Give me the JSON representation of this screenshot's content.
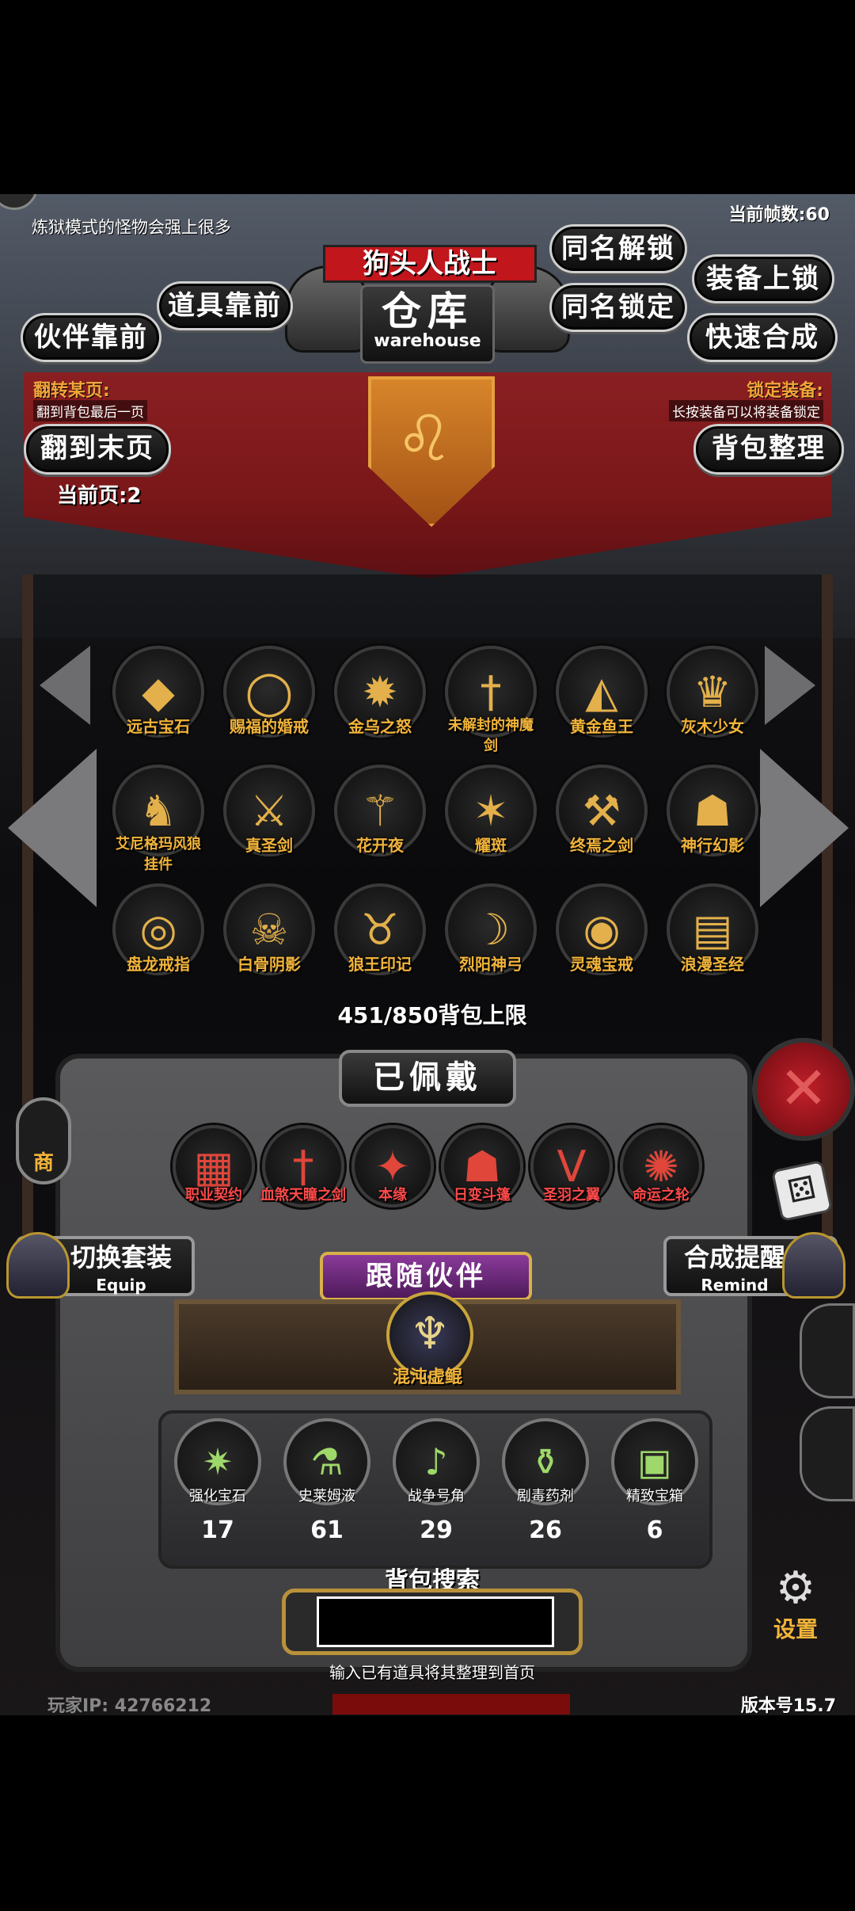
{
  "header": {
    "fps": "当前帧数:60",
    "mode_tip": "炼狱模式的怪物会强上很多",
    "character_name": "狗头人战士",
    "title": "仓库",
    "title_en": "warehouse"
  },
  "buttons": {
    "unlock_same": "同名解锁",
    "equip_lock": "装备上锁",
    "items_front": "道具靠前",
    "lock_same": "同名锁定",
    "partner_front": "伙伴靠前",
    "quick_synth": "快速合成",
    "last_page": "翻到末页",
    "bag_sort": "背包整理",
    "switch_set": "切换套装",
    "switch_set_en": "Equip",
    "synth_remind": "合成提醒",
    "synth_remind_en": "Remind"
  },
  "tips": {
    "jump_page_title": "翻转某页:",
    "jump_page_desc": "翻到背包最后一页",
    "lock_equip_title": "锁定装备:",
    "lock_equip_desc": "长按装备可以将装备锁定"
  },
  "page": {
    "current": "当前页:2"
  },
  "items": [
    {
      "name": "远古宝石",
      "icon": "gem-icon",
      "glyph": "◆"
    },
    {
      "name": "赐福的婚戒",
      "icon": "ring-icon",
      "glyph": "◯"
    },
    {
      "name": "金乌之怒",
      "icon": "fireball-icon",
      "glyph": "✹"
    },
    {
      "name": "未解封的神魔剑",
      "icon": "sword-icon",
      "glyph": "†"
    },
    {
      "name": "黄金鱼王",
      "icon": "fish-icon",
      "glyph": "◭"
    },
    {
      "name": "灰木少女",
      "icon": "girl-icon",
      "glyph": "♛"
    },
    {
      "name": "艾尼格玛风狼挂件",
      "icon": "wolf-pendant-icon",
      "glyph": "♞"
    },
    {
      "name": "真圣剑",
      "icon": "holy-sword-icon",
      "glyph": "⚔"
    },
    {
      "name": "花开夜",
      "icon": "dagger-icon",
      "glyph": "⚚"
    },
    {
      "name": "耀斑",
      "icon": "flare-staff-icon",
      "glyph": "✶"
    },
    {
      "name": "终焉之剑",
      "icon": "greatsword-icon",
      "glyph": "⚒"
    },
    {
      "name": "神行幻影",
      "icon": "cloak-icon",
      "glyph": "☗"
    },
    {
      "name": "盘龙戒指",
      "icon": "dragon-ring-icon",
      "glyph": "◎"
    },
    {
      "name": "白骨阴影",
      "icon": "skull-icon",
      "glyph": "☠"
    },
    {
      "name": "狼王印记",
      "icon": "wolf-mark-icon",
      "glyph": "♉"
    },
    {
      "name": "烈阳神弓",
      "icon": "bow-icon",
      "glyph": "☽"
    },
    {
      "name": "灵魂宝戒",
      "icon": "soul-ring-icon",
      "glyph": "◉"
    },
    {
      "name": "浪漫圣经",
      "icon": "book-icon",
      "glyph": "▤"
    }
  ],
  "capacity": "451/850背包上限",
  "equipped_title": "已佩戴",
  "equipped": [
    {
      "name": "职业契约",
      "icon": "scroll-icon",
      "glyph": "▦"
    },
    {
      "name": "血煞天瞳之剑",
      "icon": "blood-sword-icon",
      "glyph": "†"
    },
    {
      "name": "本缘",
      "icon": "crystal-icon",
      "glyph": "✦"
    },
    {
      "name": "日变斗篷",
      "icon": "red-cloak-icon",
      "glyph": "☗"
    },
    {
      "name": "圣羽之翼",
      "icon": "wings-icon",
      "glyph": "ᐯ"
    },
    {
      "name": "命运之轮",
      "icon": "wheel-icon",
      "glyph": "✺"
    }
  ],
  "partner": {
    "title": "跟随伙伴",
    "name": "混沌虚鲲",
    "icon": "chaos-whale-icon"
  },
  "consumables": [
    {
      "name": "强化宝石",
      "count": "17",
      "icon": "green-gem-icon",
      "glyph": "✷"
    },
    {
      "name": "史莱姆液",
      "count": "61",
      "icon": "potion-icon",
      "glyph": "⚗"
    },
    {
      "name": "战争号角",
      "count": "29",
      "icon": "horn-icon",
      "glyph": "♪"
    },
    {
      "name": "剧毒药剂",
      "count": "26",
      "icon": "poison-icon",
      "glyph": "⚱"
    },
    {
      "name": "精致宝箱",
      "count": "6",
      "icon": "chest-icon",
      "glyph": "▣"
    }
  ],
  "search": {
    "title": "背包搜索",
    "placeholder": "",
    "hint": "输入已有道具将其整理到首页"
  },
  "side": {
    "shop_label": "商",
    "settings_label": "设置"
  },
  "footer": {
    "player_ip": "玩家IP:  42766212",
    "version": "版本号15.7"
  },
  "colors": {
    "accent_gold": "#f2b43a",
    "banner_red": "#8a1f22",
    "equip_red": "#ff4a4a",
    "partner_purple": "#6a2a7a"
  }
}
